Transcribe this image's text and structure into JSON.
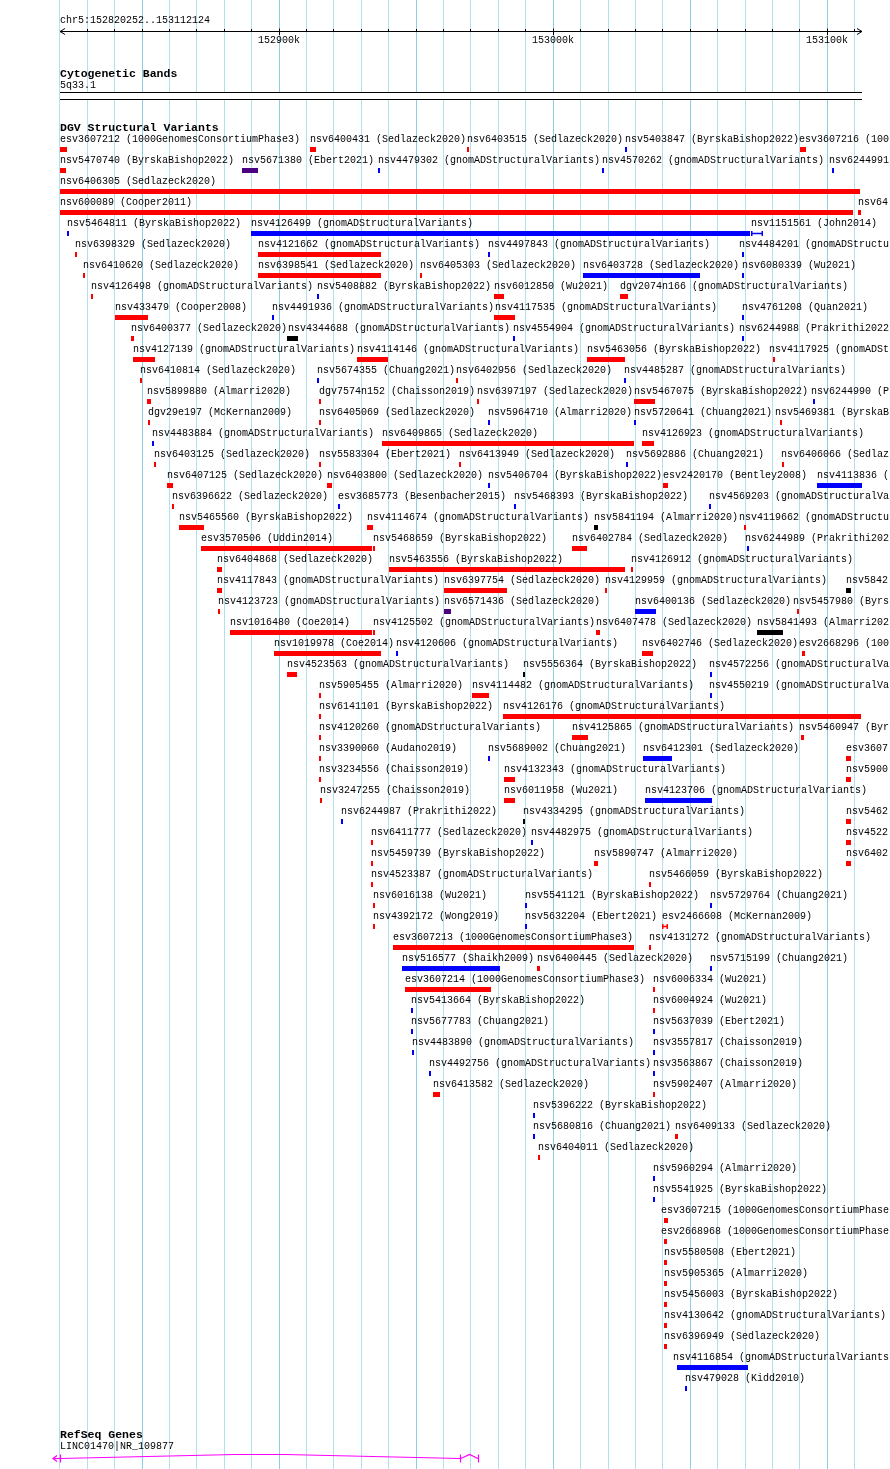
{
  "ruler": {
    "region": "chr5:152820252..153112124",
    "ticks": [
      "152900k",
      "153000k",
      "153100k"
    ]
  },
  "cytogenetic_bands": {
    "title": "Cytogenetic Bands",
    "band": "5q33.1"
  },
  "structural_variants": {
    "title": "DGV Structural Variants",
    "rows": [
      [
        {
          "label": "esv3607212 (1000GenomesConsortiumPhase3)",
          "color": "#ff0000",
          "kind": "bar"
        },
        {
          "label": "nsv6400431 (Sedlazeck2020)",
          "color": "#ff0000",
          "kind": "bar"
        },
        {
          "label": "nsv6403515 (Sedlazeck2020)",
          "color": "#ff0000",
          "kind": "bar"
        },
        {
          "label": "nsv5403847 (ByrskaBishop2022)",
          "color": "#0000ff",
          "kind": "bar"
        },
        {
          "label": "esv3607216 (100",
          "color": "#ff0000",
          "kind": "bar"
        }
      ],
      [
        {
          "label": "nsv5470740 (ByrskaBishop2022)",
          "color": "#ff0000",
          "kind": "bar"
        },
        {
          "label": "nsv5671380 (Ebert2021)",
          "color": "#4b0082",
          "kind": "bar"
        },
        {
          "label": "nsv4479302 (gnomADStructuralVariants)",
          "color": "#0000ff",
          "kind": "bar"
        },
        {
          "label": "nsv4570262 (gnomADStructuralVariants)",
          "color": "#0000ff",
          "kind": "bar"
        },
        {
          "label": "nsv6244991",
          "color": "#0000ff",
          "kind": "bar"
        }
      ],
      [
        {
          "label": "nsv6406305 (Sedlazeck2020)",
          "color": "#ff0000",
          "kind": "bar"
        }
      ],
      [
        {
          "label": "nsv600089 (Cooper2011)",
          "color": "#ff0000",
          "kind": "bar"
        },
        {
          "label": "nsv64",
          "color": "#ff0000",
          "kind": "bar"
        }
      ],
      [
        {
          "label": "nsv5464811 (ByrskaBishop2022)",
          "color": "#0000ff",
          "kind": "bar"
        },
        {
          "label": "nsv4126499 (gnomADStructuralVariants)",
          "color": "#0000ff",
          "kind": "bar"
        },
        {
          "label": "nsv1151561 (John2014)",
          "color": "#0000ff",
          "kind": "bracket"
        }
      ],
      [
        {
          "label": "nsv6398329 (Sedlazeck2020)",
          "color": "#ff0000",
          "kind": "bar"
        },
        {
          "label": "nsv4121662 (gnomADStructuralVariants)",
          "color": "#ff0000",
          "kind": "bar"
        },
        {
          "label": "nsv4497843 (gnomADStructuralVariants)",
          "color": "#0000ff",
          "kind": "bar"
        },
        {
          "label": "nsv4484201 (gnomADStructu",
          "color": "#0000ff",
          "kind": "bar"
        }
      ],
      [
        {
          "label": "nsv6410620 (Sedlazeck2020)",
          "color": "#ff0000",
          "kind": "bar"
        },
        {
          "label": "nsv6398541 (Sedlazeck2020)",
          "color": "#ff0000",
          "kind": "bar"
        },
        {
          "label": "nsv6405303 (Sedlazeck2020)",
          "color": "#ff0000",
          "kind": "bar"
        },
        {
          "label": "nsv6403728 (Sedlazeck2020)",
          "color": "#0000ff",
          "kind": "bar"
        },
        {
          "label": "nsv6080339 (Wu2021)",
          "color": "#0000ff",
          "kind": "bar"
        }
      ],
      [
        {
          "label": "nsv4126498 (gnomADStructuralVariants)",
          "color": "#ff0000",
          "kind": "bar"
        },
        {
          "label": "nsv5408882 (ByrskaBishop2022)",
          "color": "#0000ff",
          "kind": "bar"
        },
        {
          "label": "nsv6012850 (Wu2021)",
          "color": "#ff0000",
          "kind": "bar"
        },
        {
          "label": "dgv2074n166 (gnomADStructuralVariants)",
          "color": "#ff0000",
          "kind": "bar"
        }
      ],
      [
        {
          "label": "nsv433479 (Cooper2008)",
          "color": "#ff0000",
          "kind": "bar"
        },
        {
          "label": "nsv4491936 (gnomADStructuralVariants)",
          "color": "#0000ff",
          "kind": "bar"
        },
        {
          "label": "nsv4117535 (gnomADStructuralVariants)",
          "color": "#ff0000",
          "kind": "bar"
        },
        {
          "label": "nsv4761208 (Quan2021)",
          "color": "#0000ff",
          "kind": "bar"
        }
      ],
      [
        {
          "label": "nsv6400377 (Sedlazeck2020)",
          "color": "#ff0000",
          "kind": "bar"
        },
        {
          "label": "nsv4344688 (gnomADStructuralVariants)",
          "color": "#000000",
          "kind": "bar"
        },
        {
          "label": "nsv4554904 (gnomADStructuralVariants)",
          "color": "#0000ff",
          "kind": "bar"
        },
        {
          "label": "nsv6244988 (Prakrithi2022",
          "color": "#0000ff",
          "kind": "bar"
        }
      ],
      [
        {
          "label": "nsv4127139 (gnomADStructuralVariants)",
          "color": "#ff0000",
          "kind": "bar"
        },
        {
          "label": "nsv4114146 (gnomADStructuralVariants)",
          "color": "#ff0000",
          "kind": "bar"
        },
        {
          "label": "nsv5463056 (ByrskaBishop2022)",
          "color": "#ff0000",
          "kind": "bar"
        },
        {
          "label": "nsv4117925 (gnomADSt",
          "color": "#ff0000",
          "kind": "bar"
        }
      ],
      [
        {
          "label": "nsv6410814 (Sedlazeck2020)",
          "color": "#ff0000",
          "kind": "bar"
        },
        {
          "label": "nsv5674355 (Chuang2021)",
          "color": "#0000ff",
          "kind": "bar"
        },
        {
          "label": "nsv6402956 (Sedlazeck2020)",
          "color": "#ff0000",
          "kind": "bar"
        },
        {
          "label": "nsv4485287 (gnomADStructuralVariants)",
          "color": "#0000ff",
          "kind": "bar"
        }
      ],
      [
        {
          "label": "nsv5899880 (Almarri2020)",
          "color": "#ff0000",
          "kind": "bar"
        },
        {
          "label": "dgv7574n152 (Chaisson2019)",
          "color": "#ff0000",
          "kind": "bar"
        },
        {
          "label": "nsv6397197 (Sedlazeck2020)",
          "color": "#ff0000",
          "kind": "bar"
        },
        {
          "label": "nsv5467075 (ByrskaBishop2022)",
          "color": "#ff0000",
          "kind": "bar"
        },
        {
          "label": "nsv6244990 (P",
          "color": "#0000ff",
          "kind": "bar"
        }
      ],
      [
        {
          "label": "dgv29e197 (McKernan2009)",
          "color": "#ff0000",
          "kind": "bar"
        },
        {
          "label": "nsv6405069 (Sedlazeck2020)",
          "color": "#ff0000",
          "kind": "bar"
        },
        {
          "label": "nsv5964710 (Almarri2020)",
          "color": "#0000ff",
          "kind": "bar"
        },
        {
          "label": "nsv5720641 (Chuang2021)",
          "color": "#0000ff",
          "kind": "bar"
        },
        {
          "label": "nsv5469381 (ByrskaB",
          "color": "#ff0000",
          "kind": "bar"
        }
      ],
      [
        {
          "label": "nsv4483884 (gnomADStructuralVariants)",
          "color": "#0000ff",
          "kind": "bar"
        },
        {
          "label": "nsv6409865 (Sedlazeck2020)",
          "color": "#ff0000",
          "kind": "bar"
        },
        {
          "label": "nsv4126923 (gnomADStructuralVariants)",
          "color": "#ff0000",
          "kind": "bar"
        }
      ],
      [
        {
          "label": "nsv6403125 (Sedlazeck2020)",
          "color": "#ff0000",
          "kind": "bar"
        },
        {
          "label": "nsv5583304 (Ebert2021)",
          "color": "#ff0000",
          "kind": "bar"
        },
        {
          "label": "nsv6413949 (Sedlazeck2020)",
          "color": "#ff0000",
          "kind": "bar"
        },
        {
          "label": "nsv5692886 (Chuang2021)",
          "color": "#0000ff",
          "kind": "bar"
        },
        {
          "label": "nsv6406066 (Sedlaz",
          "color": "#ff0000",
          "kind": "bar"
        }
      ],
      [
        {
          "label": "nsv6407125 (Sedlazeck2020)",
          "color": "#ff0000",
          "kind": "bar"
        },
        {
          "label": "nsv6403800 (Sedlazeck2020)",
          "color": "#ff0000",
          "kind": "bar"
        },
        {
          "label": "nsv5406704 (ByrskaBishop2022)",
          "color": "#0000ff",
          "kind": "bar"
        },
        {
          "label": "esv2420170 (Bentley2008)",
          "color": "#ff0000",
          "kind": "bar"
        },
        {
          "label": "nsv4113836 (",
          "color": "#0000ff",
          "kind": "bar"
        }
      ],
      [
        {
          "label": "nsv6396622 (Sedlazeck2020)",
          "color": "#ff0000",
          "kind": "bar"
        },
        {
          "label": "esv3685773 (Besenbacher2015)",
          "color": "#0000ff",
          "kind": "bar"
        },
        {
          "label": "nsv5468393 (ByrskaBishop2022)",
          "color": "#0000ff",
          "kind": "bar"
        },
        {
          "label": "nsv4569203 (gnomADStructuralVa",
          "color": "#0000ff",
          "kind": "bar"
        }
      ],
      [
        {
          "label": "nsv5465560 (ByrskaBishop2022)",
          "color": "#ff0000",
          "kind": "bar"
        },
        {
          "label": "nsv4114674 (gnomADStructuralVariants)",
          "color": "#ff0000",
          "kind": "bar"
        },
        {
          "label": "nsv5841194 (Almarri2020)",
          "color": "#000000",
          "kind": "bar"
        },
        {
          "label": "nsv4119662 (gnomADStructu",
          "color": "#ff0000",
          "kind": "bar"
        }
      ],
      [
        {
          "label": "esv3570506 (Uddin2014)",
          "color": "#ff0000",
          "kind": "bar"
        },
        {
          "label": "nsv5468659 (ByrskaBishop2022)",
          "color": "#ff0000",
          "kind": "bar"
        },
        {
          "label": "nsv6402784 (Sedlazeck2020)",
          "color": "#ff0000",
          "kind": "bar"
        },
        {
          "label": "nsv6244989 (Prakrithi202",
          "color": "#0000ff",
          "kind": "bar"
        }
      ],
      [
        {
          "label": "nsv6404868 (Sedlazeck2020)",
          "color": "#ff0000",
          "kind": "bar"
        },
        {
          "label": "nsv5463556 (ByrskaBishop2022)",
          "color": "#ff0000",
          "kind": "bar"
        },
        {
          "label": "nsv4126912 (gnomADStructuralVariants)",
          "color": "#ff0000",
          "kind": "bar"
        }
      ],
      [
        {
          "label": "nsv4117843 (gnomADStructuralVariants)",
          "color": "#ff0000",
          "kind": "bar"
        },
        {
          "label": "nsv6397754 (Sedlazeck2020)",
          "color": "#ff0000",
          "kind": "bar"
        },
        {
          "label": "nsv4129959 (gnomADStructuralVariants)",
          "color": "#ff0000",
          "kind": "bar"
        },
        {
          "label": "nsv5842",
          "color": "#000000",
          "kind": "bar"
        }
      ],
      [
        {
          "label": "nsv4123723 (gnomADStructuralVariants)",
          "color": "#ff0000",
          "kind": "bar"
        },
        {
          "label": "nsv6571436 (Sedlazeck2020)",
          "color": "#4b0082",
          "kind": "bar"
        },
        {
          "label": "nsv6400136 (Sedlazeck2020)",
          "color": "#0000ff",
          "kind": "bar"
        },
        {
          "label": "nsv5457980 (Byrs",
          "color": "#ff0000",
          "kind": "bar"
        }
      ],
      [
        {
          "label": "nsv1016480 (Coe2014)",
          "color": "#ff0000",
          "kind": "bar"
        },
        {
          "label": "nsv4125502 (gnomADStructuralVariants)",
          "color": "#ff0000",
          "kind": "bar"
        },
        {
          "label": "nsv6407478 (Sedlazeck2020)",
          "color": "#ff0000",
          "kind": "bar"
        },
        {
          "label": "nsv5841493 (Almarri202",
          "color": "#000000",
          "kind": "bar"
        }
      ],
      [
        {
          "label": "nsv1019978 (Coe2014)",
          "color": "#ff0000",
          "kind": "bar"
        },
        {
          "label": "nsv4120606 (gnomADStructuralVariants)",
          "color": "#0000ff",
          "kind": "bar"
        },
        {
          "label": "nsv6402746 (Sedlazeck2020)",
          "color": "#ff0000",
          "kind": "bar"
        },
        {
          "label": "esv2668296 (100",
          "color": "#ff0000",
          "kind": "bar"
        }
      ],
      [
        {
          "label": "nsv4523563 (gnomADStructuralVariants)",
          "color": "#ff0000",
          "kind": "bar"
        },
        {
          "label": "nsv5556364 (ByrskaBishop2022)",
          "color": "#000000",
          "kind": "bar"
        },
        {
          "label": "nsv4572256 (gnomADStructuralVa",
          "color": "#0000ff",
          "kind": "bar"
        }
      ],
      [
        {
          "label": "nsv5905455 (Almarri2020)",
          "color": "#ff0000",
          "kind": "bar"
        },
        {
          "label": "nsv4114482 (gnomADStructuralVariants)",
          "color": "#ff0000",
          "kind": "bar"
        },
        {
          "label": "nsv4550219 (gnomADStructuralVa",
          "color": "#0000ff",
          "kind": "bar"
        }
      ],
      [
        {
          "label": "nsv6141101 (ByrskaBishop2022)",
          "color": "#ff0000",
          "kind": "bar"
        },
        {
          "label": "nsv4126176 (gnomADStructuralVariants)",
          "color": "#ff0000",
          "kind": "bar"
        }
      ],
      [
        {
          "label": "nsv4120260 (gnomADStructuralVariants)",
          "color": "#ff0000",
          "kind": "bar"
        },
        {
          "label": "nsv4125865 (gnomADStructuralVariants)",
          "color": "#ff0000",
          "kind": "bar"
        },
        {
          "label": "nsv5460947 (Byr",
          "color": "#ff0000",
          "kind": "bar"
        }
      ],
      [
        {
          "label": "nsv3390060 (Audano2019)",
          "color": "#ff0000",
          "kind": "bar"
        },
        {
          "label": "nsv5689002 (Chuang2021)",
          "color": "#0000ff",
          "kind": "bar"
        },
        {
          "label": "nsv6412301 (Sedlazeck2020)",
          "color": "#0000ff",
          "kind": "bar"
        },
        {
          "label": "esv3607",
          "color": "#ff0000",
          "kind": "bar"
        }
      ],
      [
        {
          "label": "nsv3234556 (Chaisson2019)",
          "color": "#ff0000",
          "kind": "bar"
        },
        {
          "label": "nsv4132343 (gnomADStructuralVariants)",
          "color": "#ff0000",
          "kind": "bar"
        },
        {
          "label": "nsv5900",
          "color": "#ff0000",
          "kind": "bar"
        }
      ],
      [
        {
          "label": "nsv3247255 (Chaisson2019)",
          "color": "#ff0000",
          "kind": "bar"
        },
        {
          "label": "nsv6011958 (Wu2021)",
          "color": "#ff0000",
          "kind": "bar"
        },
        {
          "label": "nsv4123706 (gnomADStructuralVariants)",
          "color": "#0000ff",
          "kind": "bar"
        }
      ],
      [
        {
          "label": "nsv6244987 (Prakrithi2022)",
          "color": "#0000ff",
          "kind": "bar"
        },
        {
          "label": "nsv4334295 (gnomADStructuralVariants)",
          "color": "#000000",
          "kind": "bar"
        },
        {
          "label": "nsv5462",
          "color": "#ff0000",
          "kind": "bar"
        }
      ],
      [
        {
          "label": "nsv6411777 (Sedlazeck2020)",
          "color": "#ff0000",
          "kind": "bar"
        },
        {
          "label": "nsv4482975 (gnomADStructuralVariants)",
          "color": "#0000ff",
          "kind": "bar"
        },
        {
          "label": "nsv4522",
          "color": "#ff0000",
          "kind": "bar"
        }
      ],
      [
        {
          "label": "nsv5459739 (ByrskaBishop2022)",
          "color": "#ff0000",
          "kind": "bar"
        },
        {
          "label": "nsv5890747 (Almarri2020)",
          "color": "#ff0000",
          "kind": "bar"
        },
        {
          "label": "nsv6402",
          "color": "#ff0000",
          "kind": "bar"
        }
      ],
      [
        {
          "label": "nsv4523387 (gnomADStructuralVariants)",
          "color": "#ff0000",
          "kind": "bar"
        },
        {
          "label": "nsv5466059 (ByrskaBishop2022)",
          "color": "#ff0000",
          "kind": "bar"
        }
      ],
      [
        {
          "label": "nsv6016138 (Wu2021)",
          "color": "#ff0000",
          "kind": "bar"
        },
        {
          "label": "nsv5541121 (ByrskaBishop2022)",
          "color": "#0000ff",
          "kind": "bar"
        },
        {
          "label": "nsv5729764 (Chuang2021)",
          "color": "#0000ff",
          "kind": "bar"
        }
      ],
      [
        {
          "label": "nsv4392172 (Wong2019)",
          "color": "#ff0000",
          "kind": "bar"
        },
        {
          "label": "nsv5632204 (Ebert2021)",
          "color": "#0000ff",
          "kind": "bar"
        },
        {
          "label": "esv2466608 (McKernan2009)",
          "color": "#ff0000",
          "kind": "bracket"
        }
      ],
      [
        {
          "label": "esv3607213 (1000GenomesConsortiumPhase3)",
          "color": "#ff0000",
          "kind": "bar"
        },
        {
          "label": "nsv4131272 (gnomADStructuralVariants)",
          "color": "#ff0000",
          "kind": "bar"
        }
      ],
      [
        {
          "label": "nsv516577 (Shaikh2009)",
          "color": "#0000ff",
          "kind": "bar"
        },
        {
          "label": "nsv6400445 (Sedlazeck2020)",
          "color": "#ff0000",
          "kind": "bar"
        },
        {
          "label": "nsv5715199 (Chuang2021)",
          "color": "#0000ff",
          "kind": "bar"
        }
      ],
      [
        {
          "label": "esv3607214 (1000GenomesConsortiumPhase3)",
          "color": "#ff0000",
          "kind": "bar"
        },
        {
          "label": "nsv6006334 (Wu2021)",
          "color": "#ff0000",
          "kind": "bar"
        }
      ],
      [
        {
          "label": "nsv5413664 (ByrskaBishop2022)",
          "color": "#0000ff",
          "kind": "bar"
        },
        {
          "label": "nsv6004924 (Wu2021)",
          "color": "#ff0000",
          "kind": "bar"
        }
      ],
      [
        {
          "label": "nsv5677783 (Chuang2021)",
          "color": "#0000ff",
          "kind": "bar"
        },
        {
          "label": "nsv5637039 (Ebert2021)",
          "color": "#0000ff",
          "kind": "bar"
        }
      ],
      [
        {
          "label": "nsv4483890 (gnomADStructuralVariants)",
          "color": "#0000ff",
          "kind": "bar"
        },
        {
          "label": "nsv3557817 (Chaisson2019)",
          "color": "#0000ff",
          "kind": "bar"
        }
      ],
      [
        {
          "label": "nsv4492756 (gnomADStructuralVariants)",
          "color": "#0000ff",
          "kind": "bar"
        },
        {
          "label": "nsv3563867 (Chaisson2019)",
          "color": "#0000ff",
          "kind": "bar"
        }
      ],
      [
        {
          "label": "nsv6413582 (Sedlazeck2020)",
          "color": "#ff0000",
          "kind": "bar"
        },
        {
          "label": "nsv5902407 (Almarri2020)",
          "color": "#ff0000",
          "kind": "bar"
        }
      ],
      [
        {
          "label": "nsv5396222 (ByrskaBishop2022)",
          "color": "#0000ff",
          "kind": "bar"
        }
      ],
      [
        {
          "label": "nsv5680816 (Chuang2021)",
          "color": "#0000ff",
          "kind": "bar"
        },
        {
          "label": "nsv6409133 (Sedlazeck2020)",
          "color": "#ff0000",
          "kind": "bar"
        }
      ],
      [
        {
          "label": "nsv6404011 (Sedlazeck2020)",
          "color": "#ff0000",
          "kind": "bar"
        }
      ],
      [
        {
          "label": "nsv5960294 (Almarri2020)",
          "color": "#0000ff",
          "kind": "bar"
        }
      ],
      [
        {
          "label": "nsv5541925 (ByrskaBishop2022)",
          "color": "#0000ff",
          "kind": "bar"
        }
      ],
      [
        {
          "label": "esv3607215 (1000GenomesConsortiumPhase",
          "color": "#ff0000",
          "kind": "bar"
        }
      ],
      [
        {
          "label": "esv2668968 (1000GenomesConsortiumPhase",
          "color": "#ff0000",
          "kind": "bar"
        }
      ],
      [
        {
          "label": "nsv5580508 (Ebert2021)",
          "color": "#ff0000",
          "kind": "bar"
        }
      ],
      [
        {
          "label": "nsv5905365 (Almarri2020)",
          "color": "#ff0000",
          "kind": "bar"
        }
      ],
      [
        {
          "label": "nsv5456003 (ByrskaBishop2022)",
          "color": "#ff0000",
          "kind": "bar"
        }
      ],
      [
        {
          "label": "nsv4130642 (gnomADStructuralVariants)",
          "color": "#ff0000",
          "kind": "bar"
        }
      ],
      [
        {
          "label": "nsv6396949 (Sedlazeck2020)",
          "color": "#ff0000",
          "kind": "bar"
        }
      ],
      [
        {
          "label": "nsv4116854 (gnomADStructuralVariants",
          "color": "#0000ff",
          "kind": "bar"
        }
      ],
      [
        {
          "label": "nsv479028 (Kidd2010)",
          "color": "#0000ff",
          "kind": "bar"
        }
      ]
    ]
  },
  "refseq_genes": {
    "title": "RefSeq Genes",
    "gene": "LINC01470|NR_109877"
  }
}
